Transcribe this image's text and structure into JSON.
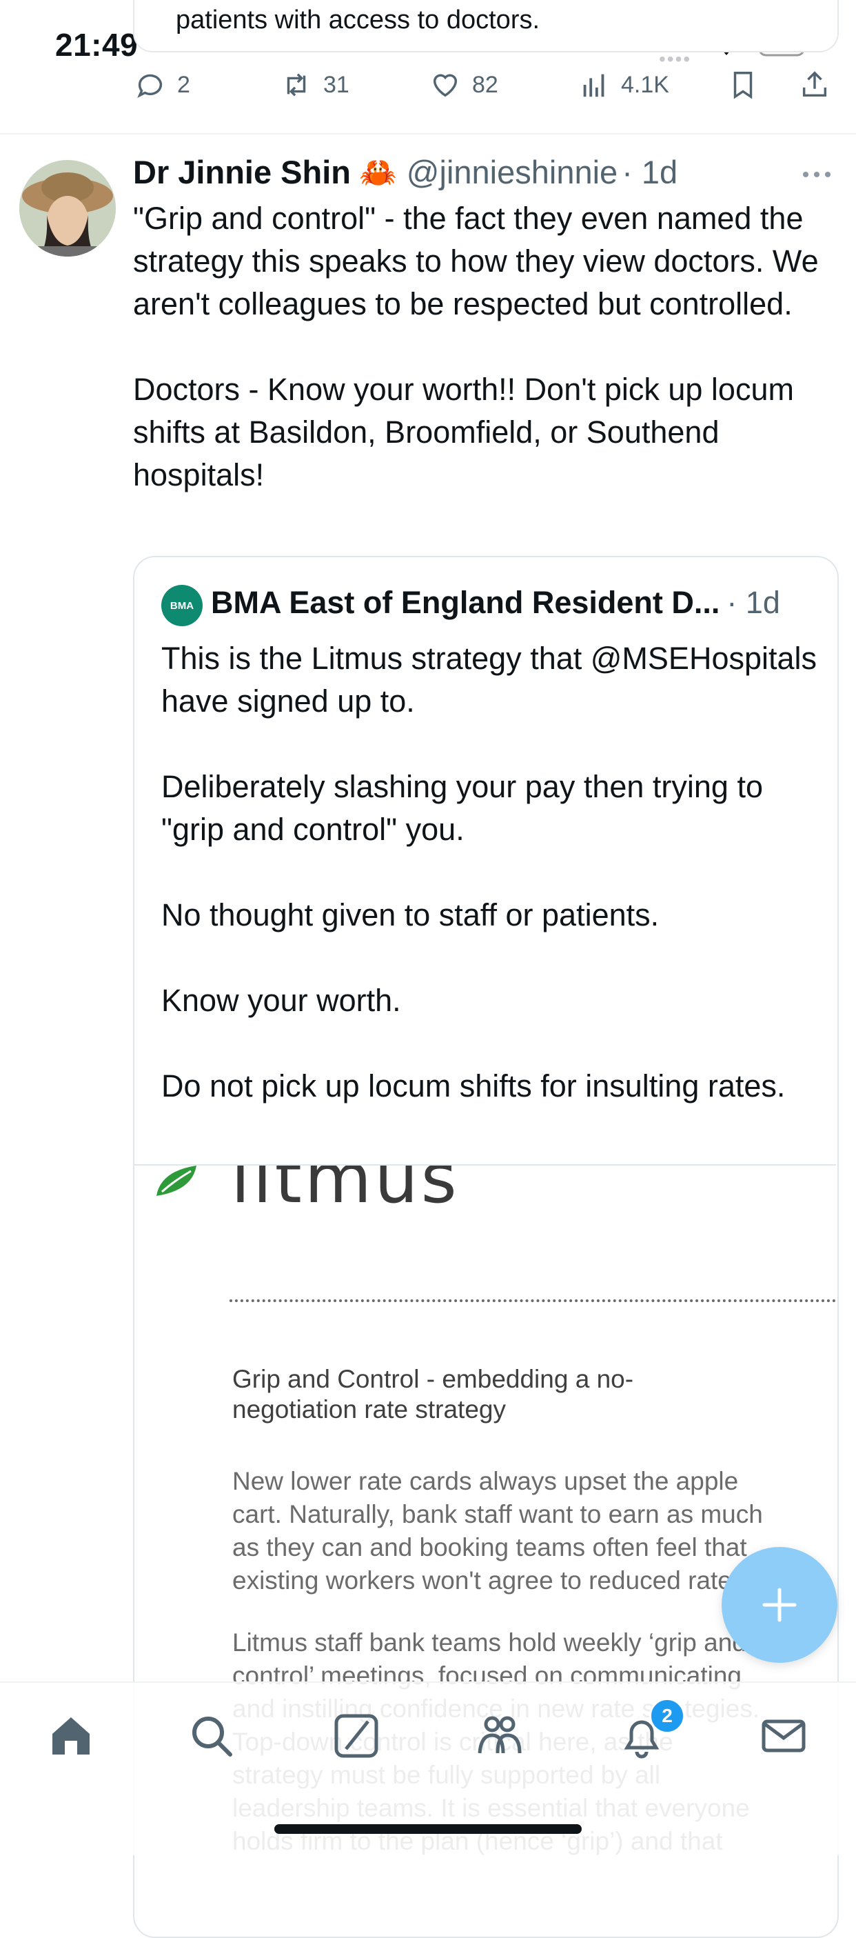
{
  "status_bar": {
    "time": "21:49"
  },
  "prev_tweet": {
    "text_tail": "patients with access to doctors.",
    "actions": {
      "replies": "2",
      "retweets": "31",
      "likes": "82",
      "views": "4.1K"
    }
  },
  "tweet": {
    "author_name": "Dr Jinnie Shin",
    "emoji": "🦀",
    "handle": "@jinnieshinnie",
    "time": "· 1d",
    "body": "\"Grip and control\" - the fact they even named the strategy this speaks to how they view doctors. We aren't colleagues to be respected but controlled.\n\nDoctors - Know your worth!! Don't pick up locum shifts at Basildon, Broomfield, or Southend hospitals!"
  },
  "quote": {
    "avatar_text": "BMA",
    "author_name": "BMA East of England Resident D...",
    "time": "· 1d",
    "body": "This is the Litmus strategy that @MSEHospitals have signed up to.\n\nDeliberately slashing your pay then trying to \"grip and control\" you.\n\nNo thought given to staff or patients.\n\nKnow your worth.\n\nDo not pick up locum shifts for insulting rates."
  },
  "document": {
    "logo_text": "litmus",
    "heading": "Grip and Control - embedding a no-negotiation rate strategy",
    "para1": "New lower rate cards always upset the apple\ncart. Naturally, bank staff want to earn as much\nas they can and booking teams often feel that\nexisting workers won't agree to reduced rates.",
    "para2": "Litmus staff bank teams hold weekly ‘grip and\ncontrol’ meetings, focused on communicating\nand instilling confidence in new rate strategies.\nTop-down control is critical here, as the\nstrategy must be fully supported by all\nleadership teams.  It is essential that everyone\nholds firm to the plan (hence ‘grip’) and that"
  },
  "nav": {
    "notifications_badge": "2"
  },
  "colors": {
    "accent": "#1d9bf0",
    "fab": "#8ecdf8",
    "muted": "#536471",
    "litmus_green": "#2e9a3a"
  }
}
